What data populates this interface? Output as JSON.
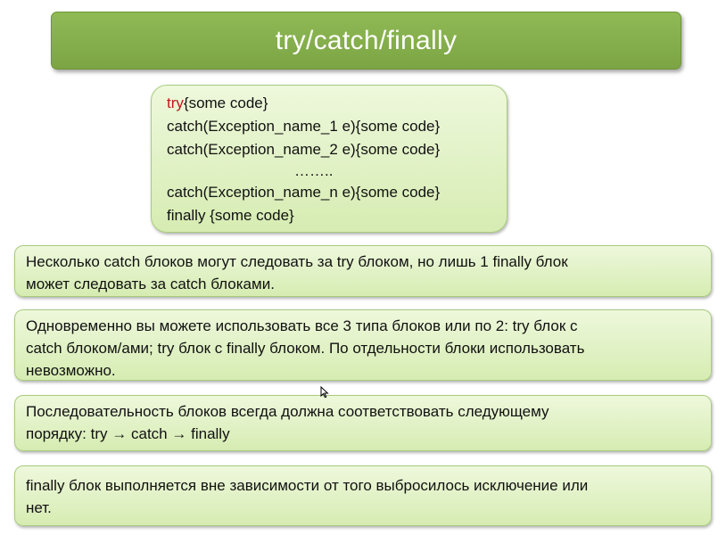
{
  "title": "try/catch/finally",
  "code_block": {
    "try_keyword": "try",
    "try_rest": "{some code}",
    "lines": [
      "catch(Exception_name_1 e){some code}",
      "catch(Exception_name_2 e){some code}",
      "……..",
      "catch(Exception_name_n e){some code}",
      "finally {some code}"
    ]
  },
  "notes": [
    {
      "lines": [
        "Несколько catch блоков могут следовать за try блоком, но лишь 1 finally блок",
        "может следовать за catch блоками."
      ]
    },
    {
      "lines": [
        "Одновременно вы можете использовать все 3 типа блоков или по 2: try блок с",
        "catch блоком/ами; try блок с finally блоком. По отдельности блоки использовать",
        "невозможно."
      ]
    },
    {
      "lines": [
        "Последовательность блоков всегда должна соответствовать следующему",
        "порядку:"
      ],
      "order": [
        "try",
        "catch",
        "finally"
      ],
      "arrow": "→"
    },
    {
      "lines": [
        "finally блок выполняется вне зависимости от того выбросилось исключение или",
        "нет."
      ]
    }
  ],
  "icons": {
    "cursor": "mouse-pointer-icon"
  }
}
